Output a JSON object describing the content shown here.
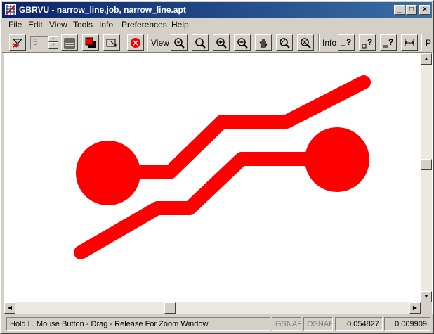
{
  "window": {
    "title": "GBRVU - narrow_line.job, narrow_line.apt",
    "minimize_glyph": "_",
    "maximize_glyph": "□",
    "close_glyph": "×"
  },
  "menu": [
    "File",
    "Edit",
    "View",
    "Tools",
    "Info",
    "Preferences",
    "Help"
  ],
  "toolbar": {
    "spin_value": "5",
    "view_label": "View",
    "info_label": "Info",
    "cut_label": "P",
    "icons": [
      "filter-off-icon",
      "layers-icon",
      "color-icon",
      "select-icon",
      "stop-icon",
      "zoom-in-icon",
      "zoom-window-icon",
      "zoom-plus-icon",
      "zoom-minus-icon",
      "pan-hand-icon",
      "zoom-fit-icon",
      "zoom-previous-icon",
      "info-point-icon",
      "info-box-icon",
      "info-net-icon",
      "measure-icon"
    ]
  },
  "colors": {
    "trace": "#ff0000",
    "titlebar_start": "#0a246a",
    "titlebar_end": "#3a6ea5"
  },
  "statusbar": {
    "message": "Hold L. Mouse Button - Drag - Release For Zoom Window",
    "gsnap": "GSNAP",
    "osnap": "OSNAP",
    "x_coord": "0.054827",
    "y_coord": "0.009909"
  }
}
